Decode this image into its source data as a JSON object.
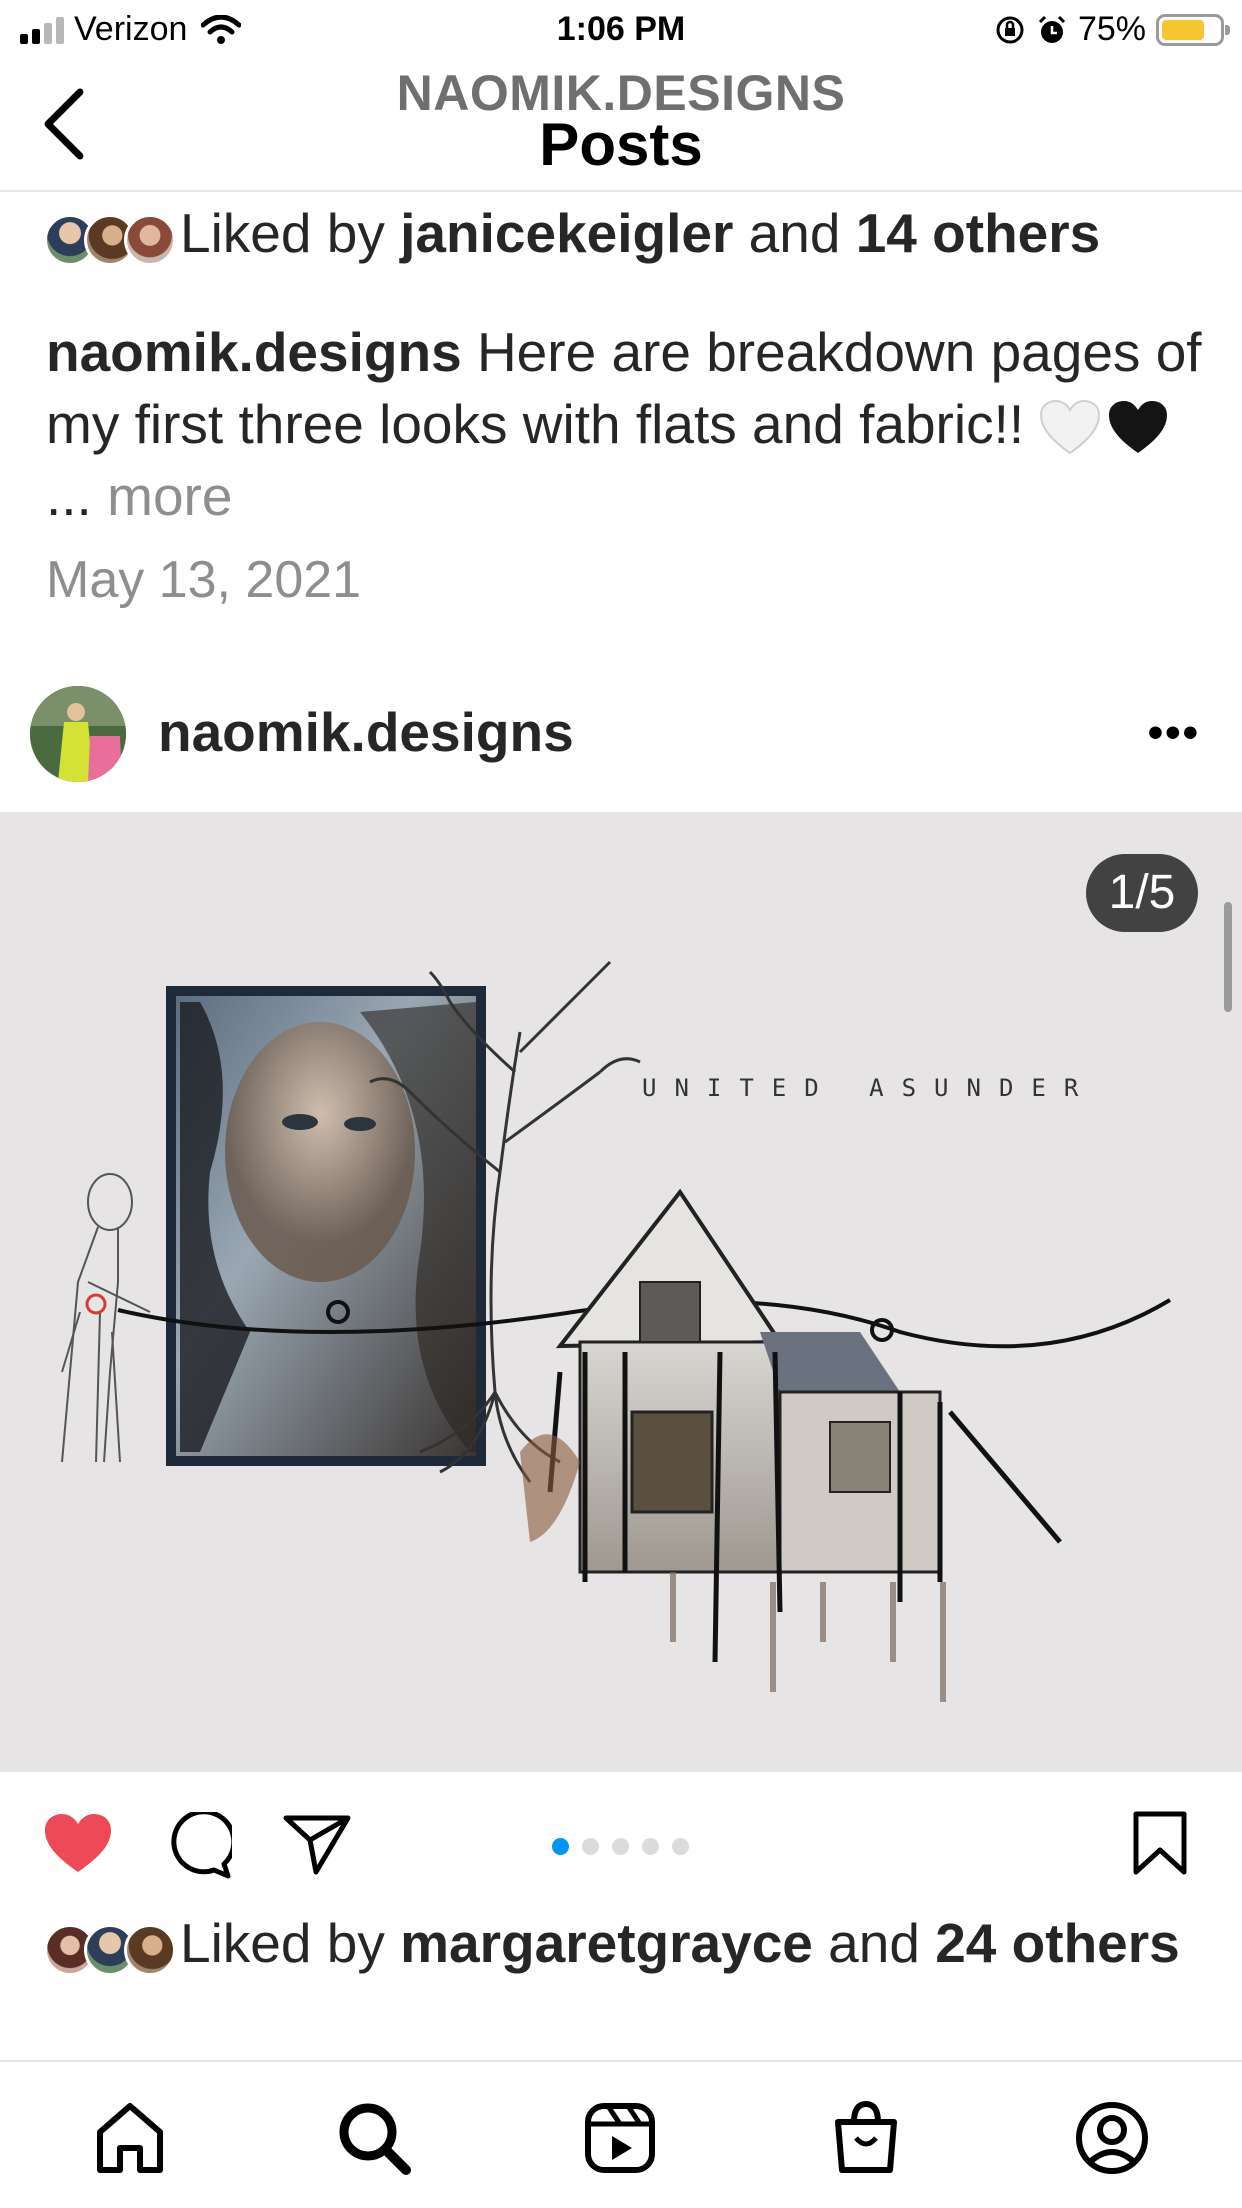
{
  "status_bar": {
    "carrier": "Verizon",
    "time": "1:06 PM",
    "battery_percent": "75%",
    "battery_level": 0.75
  },
  "header": {
    "account": "NAOMIK.DESIGNS",
    "title": "Posts"
  },
  "prev_post": {
    "liked_by_prefix": "Liked by ",
    "liked_by_user": "janicekeigler",
    "liked_by_join": " and ",
    "liked_by_count": "14 others",
    "caption_user": "naomik.designs",
    "caption_text": " Here are breakdown pages of my first three looks with flats and fabric!! ",
    "caption_ellipsis": "... ",
    "caption_more": "more",
    "date": "May 13, 2021"
  },
  "post": {
    "username": "naomik.designs",
    "more_icon": "more-horizontal-icon",
    "page_counter": "1/5",
    "art_title": "UNITED ASUNDER",
    "carousel_pages": 5,
    "carousel_active": 1,
    "liked": true,
    "liked_by_prefix": "Liked by ",
    "liked_by_user": "margaretgrayce",
    "liked_by_join": " and ",
    "liked_by_count": "24 others"
  },
  "icons": {
    "like": "heart-icon",
    "comment": "comment-icon",
    "share": "share-icon",
    "save": "bookmark-icon"
  },
  "nav": [
    "home-icon",
    "search-icon",
    "reels-icon",
    "shop-icon",
    "profile-icon"
  ],
  "colors": {
    "like_red": "#ed4956",
    "link_blue": "#0095f6",
    "battery_yellow": "#f6c631",
    "muted_text": "#8e8e8e"
  }
}
